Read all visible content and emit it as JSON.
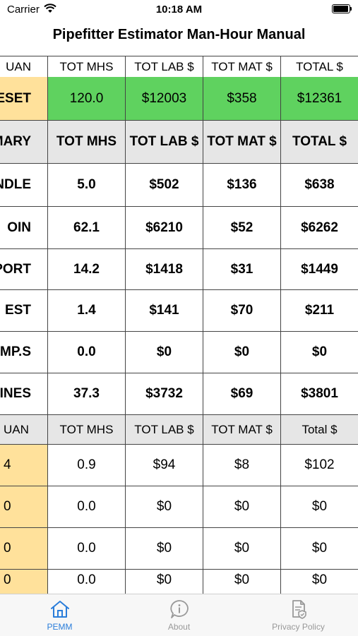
{
  "status": {
    "carrier": "Carrier",
    "time": "10:18 AM"
  },
  "title": "Pipefitter Estimator Man-Hour Manual",
  "colors": {
    "accent": "#2a7dda",
    "preset_green": "#5fd25f",
    "qty_yellow": "#ffe19b",
    "section_gray": "#e6e6e6"
  },
  "rows": [
    {
      "c0": "UAN",
      "c1": "TOT MHS",
      "c2": "TOT LAB $",
      "c3": "TOT MAT $",
      "c4": "TOTAL $"
    },
    {
      "c0": "ESET",
      "c1": "120.0",
      "c2": "$12003",
      "c3": "$358",
      "c4": "$12361"
    },
    {
      "c0": "MMARY",
      "c1": "TOT MHS",
      "c2": "TOT LAB $",
      "c3": "TOT MAT $",
      "c4": "TOTAL $"
    },
    {
      "c0": "NDLE",
      "c1": "5.0",
      "c2": "$502",
      "c3": "$136",
      "c4": "$638"
    },
    {
      "c0": "OIN",
      "c1": "62.1",
      "c2": "$6210",
      "c3": "$52",
      "c4": "$6262"
    },
    {
      "c0": "PPORT",
      "c1": "14.2",
      "c2": "$1418",
      "c3": "$31",
      "c4": "$1449"
    },
    {
      "c0": "EST",
      "c1": "1.4",
      "c2": "$141",
      "c3": "$70",
      "c4": "$211"
    },
    {
      "c0": "OMP.S",
      "c1": "0.0",
      "c2": "$0",
      "c3": "$0",
      "c4": "$0"
    },
    {
      "c0": "LINES",
      "c1": "37.3",
      "c2": "$3732",
      "c3": "$69",
      "c4": "$3801"
    },
    {
      "c0": "UAN",
      "c1": "TOT MHS",
      "c2": "TOT LAB $",
      "c3": "TOT MAT $",
      "c4": "Total $"
    },
    {
      "c0": "4",
      "c1": "0.9",
      "c2": "$94",
      "c3": "$8",
      "c4": "$102"
    },
    {
      "c0": "0",
      "c1": "0.0",
      "c2": "$0",
      "c3": "$0",
      "c4": "$0"
    },
    {
      "c0": "0",
      "c1": "0.0",
      "c2": "$0",
      "c3": "$0",
      "c4": "$0"
    },
    {
      "c0": "0",
      "c1": "0.0",
      "c2": "$0",
      "c3": "$0",
      "c4": "$0"
    }
  ],
  "tabs": [
    {
      "label": "PEMM",
      "icon": "home-icon",
      "active": true
    },
    {
      "label": "About",
      "icon": "info-icon",
      "active": false
    },
    {
      "label": "Privacy Policy",
      "icon": "privacy-document-icon",
      "active": false
    }
  ]
}
